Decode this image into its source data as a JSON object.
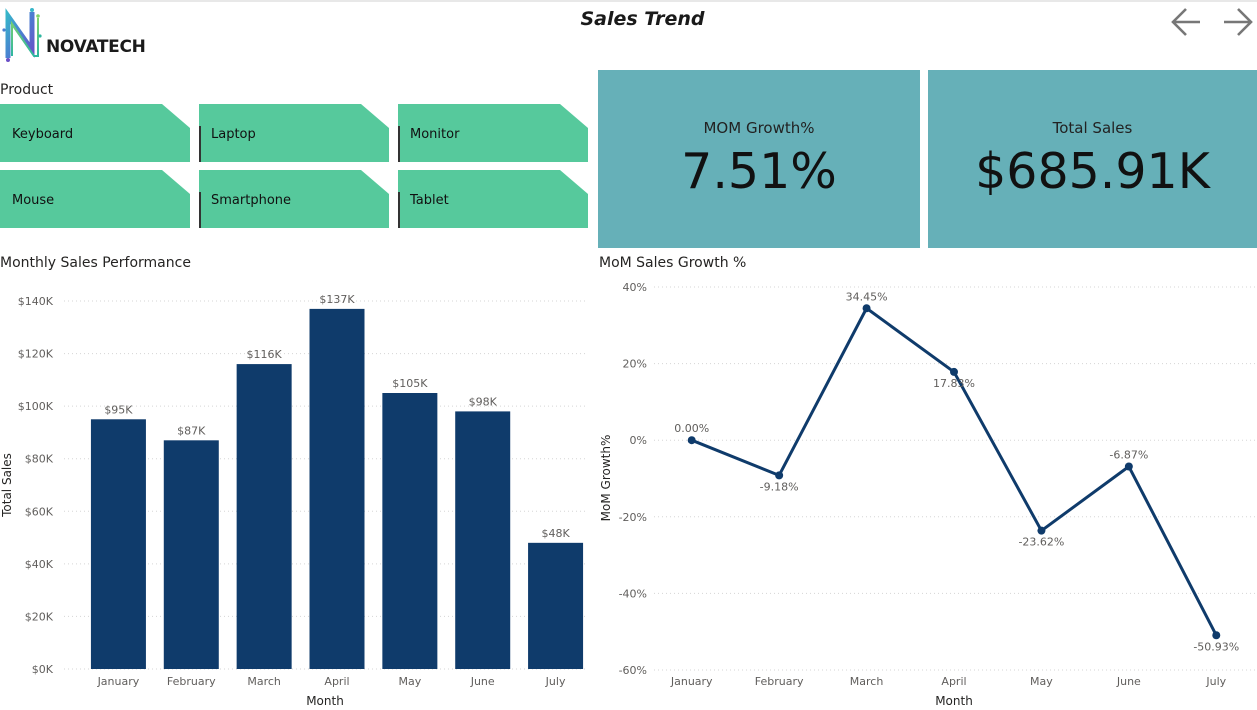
{
  "header": {
    "brand": "NOVATECH",
    "title": "Sales Trend"
  },
  "slicer": {
    "title": "Product",
    "items": [
      "Keyboard",
      "Laptop",
      "Monitor",
      "Mouse",
      "Smartphone",
      "Tablet"
    ]
  },
  "kpis": [
    {
      "label": "MOM Growth%",
      "value": "7.51%"
    },
    {
      "label": "Total Sales",
      "value": "$685.91K"
    }
  ],
  "colors": {
    "tile": "#56c99c",
    "card": "#66b0b8",
    "series": "#0f3b6b"
  },
  "chart_data": [
    {
      "type": "bar",
      "title": "Monthly Sales Performance",
      "xlabel": "Month",
      "ylabel": "Total Sales",
      "categories": [
        "January",
        "February",
        "March",
        "April",
        "May",
        "June",
        "July"
      ],
      "values": [
        95,
        87,
        116,
        137,
        105,
        98,
        48
      ],
      "value_labels": [
        "$95K",
        "$87K",
        "$116K",
        "$137K",
        "$105K",
        "$98K",
        "$48K"
      ],
      "ylim": [
        0,
        140
      ],
      "yticks": [
        0,
        20,
        40,
        60,
        80,
        100,
        120,
        140
      ],
      "ytick_labels": [
        "$0K",
        "$20K",
        "$40K",
        "$60K",
        "$80K",
        "$100K",
        "$120K",
        "$140K"
      ],
      "grid": true
    },
    {
      "type": "line",
      "title": "MoM Sales Growth %",
      "xlabel": "Month",
      "ylabel": "MoM Growth%",
      "categories": [
        "January",
        "February",
        "March",
        "April",
        "May",
        "June",
        "July"
      ],
      "values": [
        0.0,
        -9.18,
        34.45,
        17.83,
        -23.62,
        -6.87,
        -50.93
      ],
      "value_labels": [
        "0.00%",
        "-9.18%",
        "34.45%",
        "17.83%",
        "-23.62%",
        "-6.87%",
        "-50.93%"
      ],
      "ylim": [
        -60,
        40
      ],
      "yticks": [
        -60,
        -40,
        -20,
        0,
        20,
        40
      ],
      "ytick_labels": [
        "-60%",
        "-40%",
        "-20%",
        "0%",
        "20%",
        "40%"
      ],
      "grid": true
    }
  ]
}
